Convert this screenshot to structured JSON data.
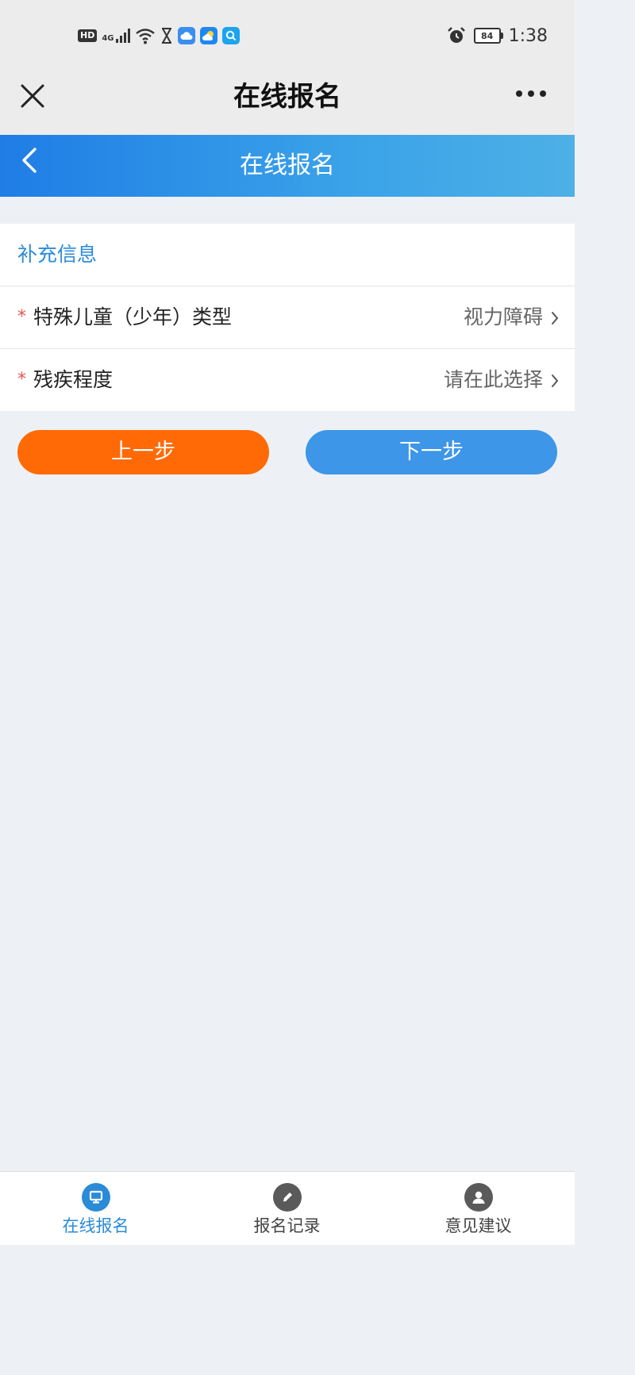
{
  "status_bar": {
    "hd": "HD",
    "network": "4G",
    "battery": "84",
    "time": "1:38",
    "icons": [
      "signal-icon",
      "wifi-icon",
      "hourglass-icon",
      "cloud-app-icon",
      "weather-app-icon",
      "search-app-icon",
      "alarm-icon",
      "battery-icon"
    ]
  },
  "nav": {
    "title": "在线报名",
    "close_icon": "close-icon",
    "more_icon": "more-icon"
  },
  "header": {
    "title": "在线报名",
    "back_icon": "back-chevron-icon"
  },
  "form": {
    "section_title": "补充信息",
    "required_mark": "*",
    "fields": [
      {
        "label": "特殊儿童（少年）类型",
        "value": "视力障碍"
      },
      {
        "label": "残疾程度",
        "value": "请在此选择"
      }
    ]
  },
  "buttons": {
    "prev": "上一步",
    "next": "下一步"
  },
  "tabs": [
    {
      "label": "在线报名",
      "icon": "computer-icon",
      "active": true
    },
    {
      "label": "报名记录",
      "icon": "pencil-icon",
      "active": false
    },
    {
      "label": "意见建议",
      "icon": "user-icon",
      "active": false
    }
  ],
  "colors": {
    "accent_blue": "#2a8bd8",
    "header_blue": "#1f7de6",
    "prev_button": "#ff6a06",
    "next_button": "#3d96e8",
    "tab_inactive_icon": "#5a5a5a",
    "required": "#e55454"
  }
}
